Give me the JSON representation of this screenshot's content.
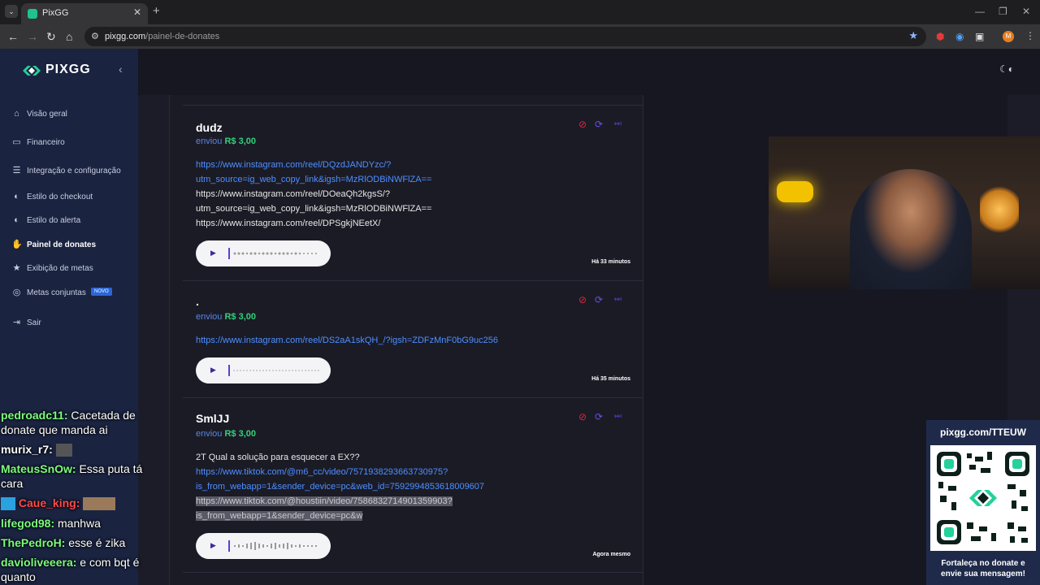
{
  "browser": {
    "tab_title": "PixGG",
    "url_host": "pixgg.com",
    "url_path": "/painel-de-donates",
    "profile_initial": "M"
  },
  "sidebar": {
    "brand": "PIXGG",
    "items": [
      {
        "label": "Visão geral",
        "icon": "home-icon"
      },
      {
        "label": "Financeiro",
        "icon": "wallet-icon"
      },
      {
        "label": "Integração e configuração",
        "icon": "settings-icon"
      },
      {
        "label": "Estilo do checkout",
        "icon": "palette-icon"
      },
      {
        "label": "Estilo do alerta",
        "icon": "palette-icon"
      },
      {
        "label": "Painel de donates",
        "icon": "donate-hand-icon",
        "active": true
      },
      {
        "label": "Exibição de metas",
        "icon": "star-icon"
      },
      {
        "label": "Metas conjuntas",
        "icon": "target-icon",
        "badge": "NOVO"
      },
      {
        "label": "Sair",
        "icon": "logout-icon"
      }
    ]
  },
  "chat": [
    {
      "user": "pedroadc11:",
      "user_color": "#7CFC7C",
      "msg": "Cacetada de",
      "msg2": "donate que manda ai"
    },
    {
      "user": "murix_r7:",
      "user_color": "#FFFFFF",
      "msg": ""
    },
    {
      "user": "MateusSnOw:",
      "user_color": "#7CFC7C",
      "msg": "Essa puta tá",
      "msg2": "cara"
    },
    {
      "user": "Caue_king:",
      "user_color": "#FF4A4A",
      "msg": ""
    },
    {
      "user": "lifegod98:",
      "user_color": "#7CFC7C",
      "msg": "manhwa"
    },
    {
      "user": "ThePedroH:",
      "user_color": "#7CFC7C",
      "msg": "esse é zika"
    },
    {
      "user": "davioliveeera:",
      "user_color": "#7CFC7C",
      "msg": "e com bqt é",
      "msg2": "quanto"
    }
  ],
  "donations": [
    {
      "donor": "dudz",
      "sent_label": "enviou",
      "amount": "R$ 3,00",
      "lines": [
        {
          "text": "https://www.instagram.com/reel/DQzdJANDYzc/?",
          "style": "link"
        },
        {
          "text": "utm_source=ig_web_copy_link&igsh=MzRlODBiNWFlZA==",
          "style": "link"
        },
        {
          "text": "https://www.instagram.com/reel/DOeaQh2kgsS/?",
          "style": "plain"
        },
        {
          "text": "utm_source=ig_web_copy_link&igsh=MzRlODBiNWFlZA==",
          "style": "plain"
        },
        {
          "text": "https://www.instagram.com/reel/DPSgkjNEetX/",
          "style": "plain"
        }
      ],
      "time": "Há 33 minutos"
    },
    {
      "donor": ".",
      "sent_label": "enviou",
      "amount": "R$ 3,00",
      "lines": [
        {
          "text": "https://www.instagram.com/reel/DS2aA1skQH_/?igsh=ZDFzMnF0bG9uc256",
          "style": "link"
        }
      ],
      "time": "Há 35 minutos"
    },
    {
      "donor": "SmlJJ",
      "sent_label": "enviou",
      "amount": "R$ 3,00",
      "lines": [
        {
          "text": "2T Qual a solução para esquecer a EX??",
          "style": "plain"
        },
        {
          "text": "https://www.tiktok.com/@m6_cc/video/7571938293663730975?",
          "style": "link"
        },
        {
          "text": "is_from_webapp=1&sender_device=pc&web_id=7592994853618009607",
          "style": "link"
        },
        {
          "text": "https://www.tiktok.com/@houstiin/video/7586832714901359903?",
          "style": "sel"
        },
        {
          "text": "is_from_webapp=1&sender_device=pc&w",
          "style": "sel"
        }
      ],
      "time": "Agora mesmo"
    }
  ],
  "qr_widget": {
    "url": "pixgg.com/TTEUW",
    "cta_line1": "Fortaleça no donate e",
    "cta_line2": "envie sua mensagem!"
  },
  "colors": {
    "sidebar_bg": "#1a2340",
    "feed_bg": "#1b1b26",
    "link": "#4d8fff",
    "amount": "#33d17a",
    "block": "#e0243c",
    "replay": "#6a4fe0"
  }
}
